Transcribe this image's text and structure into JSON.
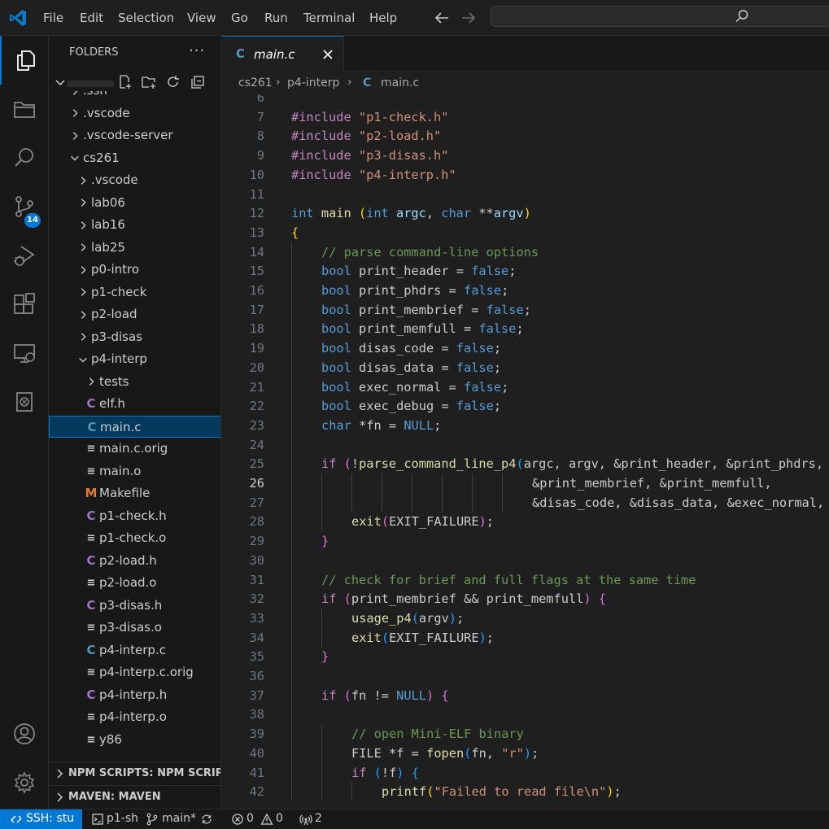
{
  "menu": [
    "File",
    "Edit",
    "Selection",
    "View",
    "Go",
    "Run",
    "Terminal",
    "Help"
  ],
  "colors": {
    "accent": "#0078d4",
    "background": "#1f1f1f",
    "sidebar": "#181818"
  },
  "activity_bar": {
    "items": [
      "explorer-icon",
      "search-icon",
      "source-control-icon",
      "run-debug-icon",
      "extensions-icon",
      "remote-explorer-icon",
      "docker-icon",
      "account-icon",
      "gear-icon"
    ],
    "source_control_badge": "14"
  },
  "sidebar": {
    "title": "FOLDERS",
    "more": "···",
    "tree": [
      {
        "label": ".ssh",
        "type": "folder",
        "depth": 0
      },
      {
        "label": ".vscode",
        "type": "folder",
        "depth": 0
      },
      {
        "label": ".vscode-server",
        "type": "folder",
        "depth": 0
      },
      {
        "label": "cs261",
        "type": "folder-open",
        "depth": 0
      },
      {
        "label": ".vscode",
        "type": "folder",
        "depth": 1
      },
      {
        "label": "lab06",
        "type": "folder",
        "depth": 1
      },
      {
        "label": "lab16",
        "type": "folder",
        "depth": 1
      },
      {
        "label": "lab25",
        "type": "folder",
        "depth": 1
      },
      {
        "label": "p0-intro",
        "type": "folder",
        "depth": 1
      },
      {
        "label": "p1-check",
        "type": "folder",
        "depth": 1
      },
      {
        "label": "p2-load",
        "type": "folder",
        "depth": 1
      },
      {
        "label": "p3-disas",
        "type": "folder",
        "depth": 1
      },
      {
        "label": "p4-interp",
        "type": "folder-open",
        "depth": 1
      },
      {
        "label": "tests",
        "type": "folder",
        "depth": 2
      },
      {
        "label": "elf.h",
        "type": "h",
        "depth": 2
      },
      {
        "label": "main.c",
        "type": "c",
        "depth": 2,
        "selected": true
      },
      {
        "label": "main.c.orig",
        "type": "lines",
        "depth": 2
      },
      {
        "label": "main.o",
        "type": "lines",
        "depth": 2
      },
      {
        "label": "Makefile",
        "type": "m",
        "depth": 2
      },
      {
        "label": "p1-check.h",
        "type": "h",
        "depth": 2
      },
      {
        "label": "p1-check.o",
        "type": "lines",
        "depth": 2
      },
      {
        "label": "p2-load.h",
        "type": "h",
        "depth": 2
      },
      {
        "label": "p2-load.o",
        "type": "lines",
        "depth": 2
      },
      {
        "label": "p3-disas.h",
        "type": "h",
        "depth": 2
      },
      {
        "label": "p3-disas.o",
        "type": "lines",
        "depth": 2
      },
      {
        "label": "p4-interp.c",
        "type": "c",
        "depth": 2
      },
      {
        "label": "p4-interp.c.orig",
        "type": "lines",
        "depth": 2
      },
      {
        "label": "p4-interp.h",
        "type": "h",
        "depth": 2
      },
      {
        "label": "p4-interp.o",
        "type": "lines",
        "depth": 2
      },
      {
        "label": "y86",
        "type": "lines",
        "depth": 2
      }
    ],
    "sections": [
      "NPM SCRIPTS: NPM SCRIP...",
      "MAVEN: MAVEN"
    ]
  },
  "tab": {
    "icon": "C",
    "label": "main.c"
  },
  "breadcrumb": [
    "cs261",
    "p4-interp",
    "main.c"
  ],
  "editor": {
    "current_line": 26,
    "lines": [
      {
        "n": "6",
        "indent": 0,
        "tokens": []
      },
      {
        "n": "7",
        "indent": 0,
        "tokens": [
          [
            "kw",
            "#include"
          ],
          [
            "def",
            " "
          ],
          [
            "str",
            "\"p1-check.h\""
          ]
        ]
      },
      {
        "n": "8",
        "indent": 0,
        "tokens": [
          [
            "kw",
            "#include"
          ],
          [
            "def",
            " "
          ],
          [
            "str",
            "\"p2-load.h\""
          ]
        ]
      },
      {
        "n": "9",
        "indent": 0,
        "tokens": [
          [
            "kw",
            "#include"
          ],
          [
            "def",
            " "
          ],
          [
            "str",
            "\"p3-disas.h\""
          ]
        ]
      },
      {
        "n": "10",
        "indent": 0,
        "tokens": [
          [
            "kw",
            "#include"
          ],
          [
            "def",
            " "
          ],
          [
            "str",
            "\"p4-interp.h\""
          ]
        ]
      },
      {
        "n": "11",
        "indent": 0,
        "tokens": []
      },
      {
        "n": "12",
        "indent": 0,
        "tokens": [
          [
            "type",
            "int"
          ],
          [
            "def",
            " "
          ],
          [
            "fn",
            "main"
          ],
          [
            "def",
            " "
          ],
          [
            "b1",
            "("
          ],
          [
            "type",
            "int"
          ],
          [
            "def",
            " "
          ],
          [
            "var",
            "argc"
          ],
          [
            "def",
            ", "
          ],
          [
            "type",
            "char"
          ],
          [
            "def",
            " **"
          ],
          [
            "var",
            "argv"
          ],
          [
            "b1",
            ")"
          ]
        ]
      },
      {
        "n": "13",
        "indent": 0,
        "tokens": [
          [
            "b1",
            "{"
          ]
        ]
      },
      {
        "n": "14",
        "indent": 1,
        "tokens": [
          [
            "com",
            "// parse command-line options"
          ]
        ]
      },
      {
        "n": "15",
        "indent": 1,
        "tokens": [
          [
            "type",
            "bool"
          ],
          [
            "def",
            " print_header = "
          ],
          [
            "type",
            "false"
          ],
          [
            "def",
            ";"
          ]
        ]
      },
      {
        "n": "16",
        "indent": 1,
        "tokens": [
          [
            "type",
            "bool"
          ],
          [
            "def",
            " print_phdrs = "
          ],
          [
            "type",
            "false"
          ],
          [
            "def",
            ";"
          ]
        ]
      },
      {
        "n": "17",
        "indent": 1,
        "tokens": [
          [
            "type",
            "bool"
          ],
          [
            "def",
            " print_membrief = "
          ],
          [
            "type",
            "false"
          ],
          [
            "def",
            ";"
          ]
        ]
      },
      {
        "n": "18",
        "indent": 1,
        "tokens": [
          [
            "type",
            "bool"
          ],
          [
            "def",
            " print_memfull = "
          ],
          [
            "type",
            "false"
          ],
          [
            "def",
            ";"
          ]
        ]
      },
      {
        "n": "19",
        "indent": 1,
        "tokens": [
          [
            "type",
            "bool"
          ],
          [
            "def",
            " disas_code = "
          ],
          [
            "type",
            "false"
          ],
          [
            "def",
            ";"
          ]
        ]
      },
      {
        "n": "20",
        "indent": 1,
        "tokens": [
          [
            "type",
            "bool"
          ],
          [
            "def",
            " disas_data = "
          ],
          [
            "type",
            "false"
          ],
          [
            "def",
            ";"
          ]
        ]
      },
      {
        "n": "21",
        "indent": 1,
        "tokens": [
          [
            "type",
            "bool"
          ],
          [
            "def",
            " exec_normal = "
          ],
          [
            "type",
            "false"
          ],
          [
            "def",
            ";"
          ]
        ]
      },
      {
        "n": "22",
        "indent": 1,
        "tokens": [
          [
            "type",
            "bool"
          ],
          [
            "def",
            " exec_debug = "
          ],
          [
            "type",
            "false"
          ],
          [
            "def",
            ";"
          ]
        ]
      },
      {
        "n": "23",
        "indent": 1,
        "tokens": [
          [
            "type",
            "char"
          ],
          [
            "def",
            " *fn = "
          ],
          [
            "type",
            "NULL"
          ],
          [
            "def",
            ";"
          ]
        ]
      },
      {
        "n": "24",
        "indent": 1,
        "tokens": []
      },
      {
        "n": "25",
        "indent": 1,
        "tokens": [
          [
            "kw",
            "if"
          ],
          [
            "def",
            " "
          ],
          [
            "b2",
            "("
          ],
          [
            "def",
            "!"
          ],
          [
            "fn",
            "parse_command_line_p4"
          ],
          [
            "b3",
            "("
          ],
          [
            "def",
            "argc, argv, &print_header, &print_phdrs,"
          ]
        ]
      },
      {
        "n": "26",
        "indent": 8,
        "tokens": [
          [
            "def",
            "&print_membrief, &print_memfull,"
          ]
        ]
      },
      {
        "n": "27",
        "indent": 8,
        "tokens": [
          [
            "def",
            "&disas_code, &disas_data, &exec_normal, &exec_debug, &fn"
          ],
          [
            "b3",
            ")"
          ],
          [
            "b2",
            ")"
          ],
          [
            "def",
            " {"
          ]
        ]
      },
      {
        "n": "28",
        "indent": 2,
        "tokens": [
          [
            "fn",
            "exit"
          ],
          [
            "b2",
            "("
          ],
          [
            "def",
            "EXIT_FAILURE"
          ],
          [
            "b2",
            ")"
          ],
          [
            "def",
            ";"
          ]
        ]
      },
      {
        "n": "29",
        "indent": 1,
        "tokens": [
          [
            "b2",
            "}"
          ]
        ]
      },
      {
        "n": "30",
        "indent": 1,
        "tokens": []
      },
      {
        "n": "31",
        "indent": 1,
        "tokens": [
          [
            "com",
            "// check for brief and full flags at the same time"
          ]
        ]
      },
      {
        "n": "32",
        "indent": 1,
        "tokens": [
          [
            "kw",
            "if"
          ],
          [
            "def",
            " "
          ],
          [
            "b2",
            "("
          ],
          [
            "def",
            "print_membrief && print_memfull"
          ],
          [
            "b2",
            ")"
          ],
          [
            "def",
            " "
          ],
          [
            "b2",
            "{"
          ]
        ]
      },
      {
        "n": "33",
        "indent": 2,
        "tokens": [
          [
            "fn",
            "usage_p4"
          ],
          [
            "b3",
            "("
          ],
          [
            "def",
            "argv"
          ],
          [
            "b3",
            ")"
          ],
          [
            "def",
            ";"
          ]
        ]
      },
      {
        "n": "34",
        "indent": 2,
        "tokens": [
          [
            "fn",
            "exit"
          ],
          [
            "b3",
            "("
          ],
          [
            "def",
            "EXIT_FAILURE"
          ],
          [
            "b3",
            ")"
          ],
          [
            "def",
            ";"
          ]
        ]
      },
      {
        "n": "35",
        "indent": 1,
        "tokens": [
          [
            "b2",
            "}"
          ]
        ]
      },
      {
        "n": "36",
        "indent": 1,
        "tokens": []
      },
      {
        "n": "37",
        "indent": 1,
        "tokens": [
          [
            "kw",
            "if"
          ],
          [
            "def",
            " "
          ],
          [
            "b2",
            "("
          ],
          [
            "def",
            "fn != "
          ],
          [
            "type",
            "NULL"
          ],
          [
            "b2",
            ")"
          ],
          [
            "def",
            " "
          ],
          [
            "b2",
            "{"
          ]
        ]
      },
      {
        "n": "38",
        "indent": 1,
        "tokens": []
      },
      {
        "n": "39",
        "indent": 2,
        "tokens": [
          [
            "com",
            "// open Mini-ELF binary"
          ]
        ]
      },
      {
        "n": "40",
        "indent": 2,
        "tokens": [
          [
            "def",
            "FILE *f = "
          ],
          [
            "fn",
            "fopen"
          ],
          [
            "b3",
            "("
          ],
          [
            "def",
            "fn, "
          ],
          [
            "str",
            "\"r\""
          ],
          [
            "b3",
            ")"
          ],
          [
            "def",
            ";"
          ]
        ]
      },
      {
        "n": "41",
        "indent": 2,
        "tokens": [
          [
            "kw",
            "if"
          ],
          [
            "def",
            " "
          ],
          [
            "b3",
            "("
          ],
          [
            "def",
            "!f"
          ],
          [
            "b3",
            ")"
          ],
          [
            "def",
            " "
          ],
          [
            "b3",
            "{"
          ]
        ]
      },
      {
        "n": "42",
        "indent": 3,
        "tokens": [
          [
            "fn",
            "printf"
          ],
          [
            "b1",
            "("
          ],
          [
            "str",
            "\"Failed to read file\\n\""
          ],
          [
            "b1",
            ")"
          ],
          [
            "def",
            ";"
          ]
        ]
      }
    ]
  },
  "statusbar": {
    "remote": "SSH: stu",
    "terminal": "p1-sh",
    "branch": "main*",
    "errors": "0",
    "warnings": "0",
    "ports": "2"
  }
}
